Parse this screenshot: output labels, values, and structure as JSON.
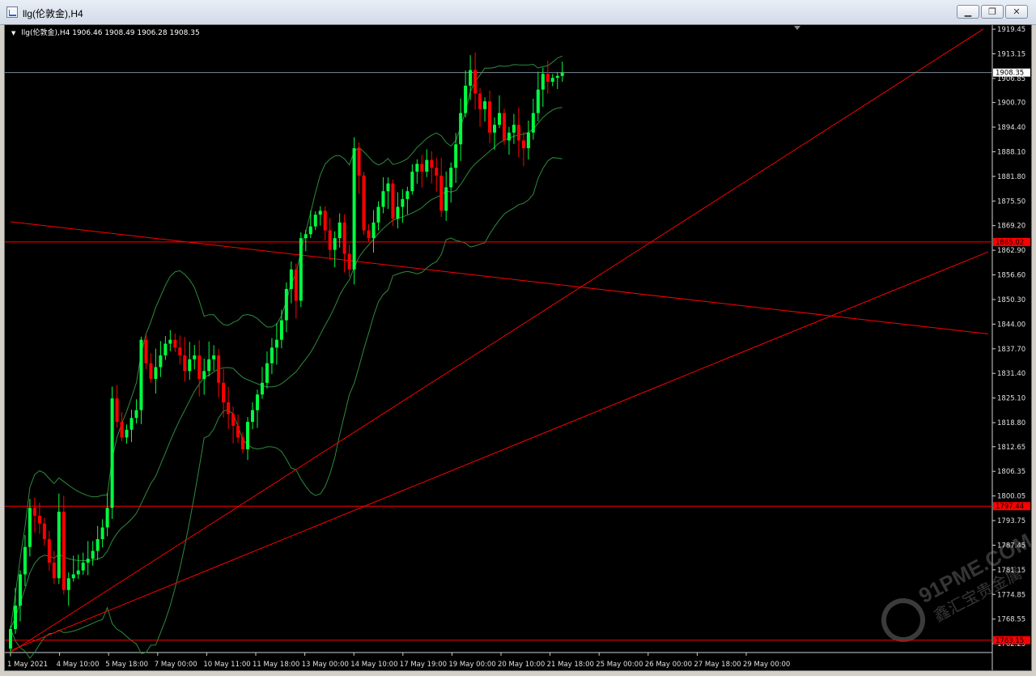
{
  "window": {
    "title": "llg(伦敦金),H4"
  },
  "header": {
    "symbol": "llg(伦敦金),H4",
    "ohlc": "1906.46 1908.49 1906.28 1908.35"
  },
  "colors": {
    "background": "#000000",
    "bull": "#00ff40",
    "bear": "#ff0000",
    "band": "#2e8b3d",
    "hline": "#ff0000",
    "priceLine": "#7a8899"
  },
  "watermark": {
    "text": "91PME.COM",
    "subtext": "鑫汇宝贵金属"
  },
  "chart_data": {
    "type": "candlestick",
    "title": "llg(伦敦金),H4",
    "ylim": [
      1760,
      1920.5
    ],
    "y_ticks": [
      "1919.45",
      "1913.15",
      "1906.85",
      "1900.70",
      "1894.40",
      "1888.10",
      "1881.80",
      "1875.50",
      "1869.20",
      "1862.90",
      "1856.60",
      "1850.30",
      "1844.00",
      "1837.70",
      "1831.40",
      "1825.10",
      "1818.80",
      "1812.65",
      "1806.35",
      "1800.05",
      "1793.75",
      "1787.45",
      "1781.15",
      "1774.85",
      "1768.55",
      "1762.25"
    ],
    "x_ticks": [
      "1 May 2021",
      "4 May 10:00",
      "5 May 18:00",
      "7 May 00:00",
      "10 May 11:00",
      "11 May 18:00",
      "13 May 00:00",
      "14 May 10:00",
      "17 May 19:00",
      "19 May 00:00",
      "20 May 10:00",
      "21 May 18:00",
      "25 May 00:00",
      "26 May 00:00",
      "27 May 18:00",
      "29 May 00:00"
    ],
    "current_price": "1908.35",
    "horizontal_levels": [
      "1865.02",
      "1797.44",
      "1763.15"
    ],
    "closes": [
      1766,
      1772,
      1780,
      1787,
      1797,
      1795,
      1793,
      1789,
      1783,
      1779,
      1796,
      1776,
      1779,
      1780,
      1781,
      1783,
      1784,
      1786,
      1789,
      1792,
      1797,
      1825,
      1819,
      1815,
      1817,
      1820,
      1822,
      1840,
      1834,
      1830,
      1833,
      1836,
      1839,
      1840,
      1838,
      1836,
      1832,
      1835,
      1836,
      1830,
      1832,
      1835,
      1836,
      1829,
      1824,
      1821,
      1818,
      1815,
      1812,
      1819,
      1822,
      1826,
      1829,
      1834,
      1838,
      1840,
      1845,
      1853,
      1858,
      1850,
      1866,
      1867,
      1869,
      1872,
      1873,
      1868,
      1863,
      1866,
      1870,
      1862,
      1858,
      1889,
      1882,
      1868,
      1866,
      1870,
      1874,
      1878,
      1880,
      1871,
      1874,
      1876,
      1878,
      1883,
      1885,
      1883,
      1886,
      1884,
      1882,
      1873,
      1879,
      1884,
      1890,
      1898,
      1905,
      1909,
      1903,
      1899,
      1901,
      1893,
      1895,
      1898,
      1891,
      1893,
      1895,
      1891,
      1889,
      1893,
      1898,
      1904,
      1908,
      1906,
      1907,
      1907.5,
      1908.35
    ]
  }
}
